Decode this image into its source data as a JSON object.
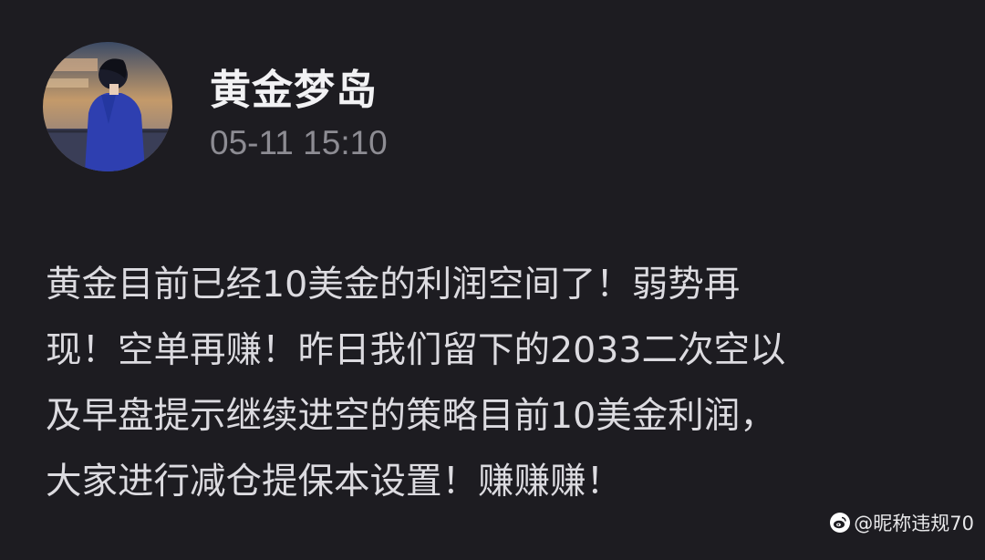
{
  "author": {
    "name": "黄金梦岛",
    "time": "05-11 15:10",
    "avatar_icon": "user-avatar-boy-in-blue-hoodie"
  },
  "post": {
    "lines": [
      "黄金目前已经10美金的利润空间了！弱势再",
      "现！空单再赚！昨日我们留下的2033二次空以",
      "及早盘提示继续进空的策略目前10美金利润，",
      "大家进行减仓提保本设置！赚赚赚！"
    ]
  },
  "watermark": {
    "text": "@昵称违规70",
    "icon": "weibo-logo-icon"
  },
  "colors": {
    "background": "#1d1c21",
    "username": "#f2f2f4",
    "time": "#8d8c93",
    "body_text": "#dcdbe0"
  }
}
